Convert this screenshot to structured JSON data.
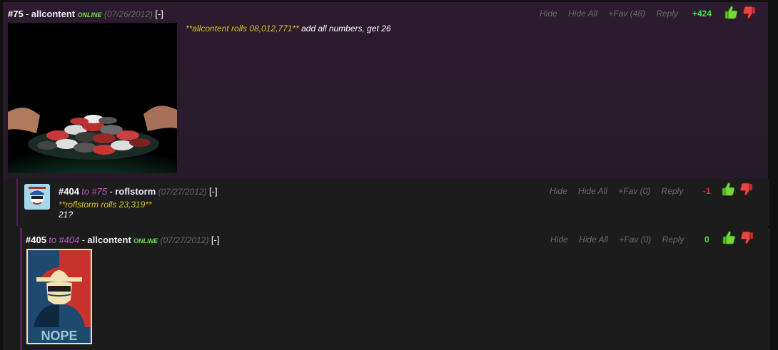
{
  "posts": [
    {
      "number": "#75",
      "separator": "-",
      "username": "allcontent",
      "online": "ONLINE",
      "date": "(07/26/2012)",
      "collapse": "[-]",
      "actions": {
        "hide": "Hide",
        "hide_all": "Hide All",
        "fav": "+Fav (48)",
        "reply": "Reply"
      },
      "score": "+424",
      "roll_text": "**allcontent rolls 08,012,771**",
      "message": "add all numbers, get 26",
      "colors": {
        "score": "#46e046"
      }
    },
    {
      "number": "#404",
      "to_label": "to",
      "to_number": "#75",
      "separator": "-",
      "username": "roflstorm",
      "date": "(07/27/2012)",
      "collapse": "[-]",
      "actions": {
        "hide": "Hide",
        "hide_all": "Hide All",
        "fav": "+Fav (0)",
        "reply": "Reply"
      },
      "score": "-1",
      "roll_text": "**roflstorm rolls 23,319**",
      "message": "21?",
      "colors": {
        "score": "#e03030"
      }
    },
    {
      "number": "#405",
      "to_label": "to",
      "to_number": "#404",
      "separator": "-",
      "username": "allcontent",
      "online": "ONLINE",
      "date": "(07/27/2012)",
      "collapse": "[-]",
      "actions": {
        "hide": "Hide",
        "hide_all": "Hide All",
        "fav": "+Fav (0)",
        "reply": "Reply"
      },
      "score": "0",
      "image_text": "NOPE",
      "colors": {
        "score": "#46e046"
      }
    }
  ],
  "icons": [
    "thumbs-up-icon",
    "thumbs-down-icon"
  ]
}
